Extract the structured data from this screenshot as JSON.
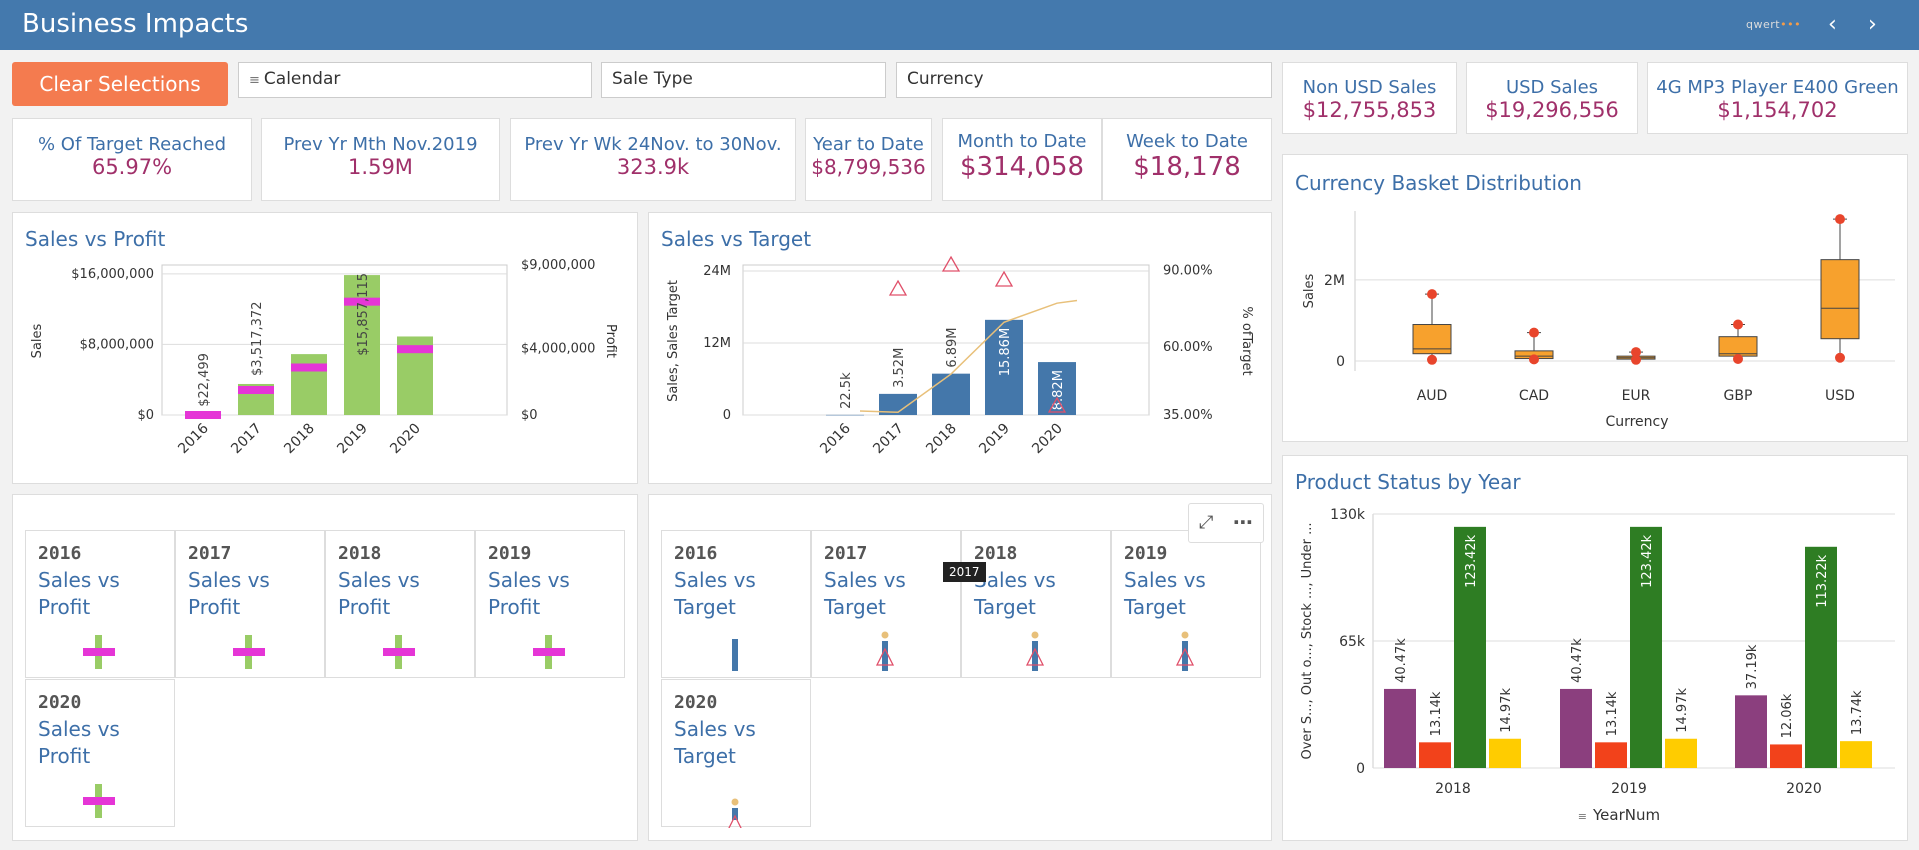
{
  "header": {
    "title": "Business Impacts",
    "logo_text": "qwert",
    "logo_dots": "•••",
    "prev_icon": "chevron-left-icon",
    "next_icon": "chevron-right-icon"
  },
  "toolbar": {
    "clear_label": "Clear Selections",
    "filters": [
      {
        "label": "Calendar",
        "has_icon": true
      },
      {
        "label": "Sale Type",
        "has_icon": false
      },
      {
        "label": "Currency",
        "has_icon": false
      }
    ]
  },
  "top_kpis": [
    {
      "label": "Non USD Sales",
      "value": "$12,755,853"
    },
    {
      "label": "USD Sales",
      "value": "$19,296,556"
    },
    {
      "label": "4G MP3 Player E400 Green",
      "value": "$1,154,702"
    }
  ],
  "kpis": [
    {
      "label": "% Of Target Reached",
      "value": "65.97%"
    },
    {
      "label": "Prev Yr Mth Nov.2019",
      "value": "1.59M"
    },
    {
      "label": "Prev Yr Wk 24Nov. to 30Nov.",
      "value": "323.9k"
    },
    {
      "label": "Year to Date",
      "value": "$8,799,536"
    },
    {
      "label": "Month to Date",
      "value": "$314,058"
    },
    {
      "label": "Week to Date",
      "value": "$18,178"
    }
  ],
  "colors": {
    "green_bar": "#99cc66",
    "magenta": "#e535d6",
    "blue_bar": "#4477aa",
    "orange_box": "#f7a12d",
    "purple": "#8b3f7e",
    "red_orange": "#f2421b",
    "dark_green": "#2e7d23",
    "yellow": "#ffcc00",
    "accent_title": "#3d6fa8",
    "kpi_value": "#a0306a"
  },
  "chart_data": [
    {
      "type": "bar",
      "title": "Sales vs Profit",
      "categories": [
        "2016",
        "2017",
        "2018",
        "2019",
        "2020"
      ],
      "series": [
        {
          "name": "Sales",
          "values": [
            22499,
            3517372,
            6900000,
            15857115,
            8900000
          ],
          "labels": [
            "$22,499",
            "$3,517,372",
            "",
            "$15,857,115",
            ""
          ]
        },
        {
          "name": "Profit",
          "values": [
            0,
            1500000,
            2850000,
            6800000,
            3950000
          ]
        }
      ],
      "ylabel": "Sales",
      "y2label": "Profit",
      "yticks": [
        "$16,000,000",
        "$8,000,000",
        "$0"
      ],
      "y2ticks": [
        "$9,000,000",
        "$4,000,000",
        "$0"
      ],
      "ylim": [
        0,
        17000000
      ],
      "y2lim": [
        0,
        9000000
      ]
    },
    {
      "type": "bar",
      "title": "Sales vs Target",
      "categories": [
        "2016",
        "2017",
        "2018",
        "2019",
        "2020"
      ],
      "series": [
        {
          "name": "Sales",
          "values": [
            22500,
            3520000,
            6890000,
            15860000,
            8820000
          ],
          "labels": [
            "22.5k",
            "3.52M",
            "6.89M",
            "15.86M",
            "8.82M"
          ]
        },
        {
          "name": "Target",
          "values": [
            null,
            21000000,
            25000000,
            22500000,
            1500000
          ]
        },
        {
          "name": "% of Target",
          "values": [
            null,
            36,
            50,
            69,
            76
          ]
        }
      ],
      "ylabel": "Sales, Sales Target",
      "y2label": "% ofTarget",
      "yticks": [
        "24M",
        "12M",
        "0"
      ],
      "y2ticks": [
        "90.00%",
        "60.00%",
        "35.00%"
      ],
      "ylim": [
        0,
        25000000
      ],
      "y2lim": [
        35,
        90
      ]
    },
    {
      "type": "box",
      "title": "Currency Basket Distribution",
      "categories": [
        "AUD",
        "CAD",
        "EUR",
        "GBP",
        "USD"
      ],
      "boxes": [
        {
          "min": 30000,
          "q1": 180000,
          "median": 300000,
          "q3": 900000,
          "max": 1650000
        },
        {
          "min": 40000,
          "q1": 60000,
          "median": 120000,
          "q3": 250000,
          "max": 700000
        },
        {
          "min": 30000,
          "q1": 50000,
          "median": 80000,
          "q3": 120000,
          "max": 220000
        },
        {
          "min": 50000,
          "q1": 120000,
          "median": 180000,
          "q3": 600000,
          "max": 900000
        },
        {
          "min": 80000,
          "q1": 550000,
          "median": 1300000,
          "q3": 2500000,
          "max": 3500000
        }
      ],
      "xlabel": "Currency",
      "ylabel": "Sales",
      "yticks": [
        "2M",
        "0"
      ],
      "ylim": [
        0,
        3700000
      ]
    },
    {
      "type": "bar",
      "title": "Product Status by Year",
      "categories": [
        "2018",
        "2019",
        "2020"
      ],
      "series": [
        {
          "name": "Over Stock",
          "values": [
            40470,
            40470,
            37190
          ],
          "labels": [
            "40.47k",
            "40.47k",
            "37.19k"
          ]
        },
        {
          "name": "Out of Stock",
          "values": [
            13140,
            13140,
            12060
          ],
          "labels": [
            "13.14k",
            "13.14k",
            "12.06k"
          ]
        },
        {
          "name": "Stock",
          "values": [
            123420,
            123420,
            113220
          ],
          "labels": [
            "123.42k",
            "123.42k",
            "113.22k"
          ]
        },
        {
          "name": "Under Stock",
          "values": [
            14970,
            14970,
            13740
          ],
          "labels": [
            "14.97k",
            "14.97k",
            "13.74k"
          ]
        }
      ],
      "xlabel": "YearNum",
      "ylabel": "Over S..., Out o..., Stock ..., Under ...",
      "yticks": [
        "130k",
        "65k",
        "0"
      ],
      "ylim": [
        0,
        130000
      ]
    }
  ],
  "profit_cards": [
    {
      "year": "2016",
      "title": "Sales vs Profit"
    },
    {
      "year": "2017",
      "title": "Sales vs Profit"
    },
    {
      "year": "2018",
      "title": "Sales vs Profit"
    },
    {
      "year": "2019",
      "title": "Sales vs Profit"
    },
    {
      "year": "2020",
      "title": "Sales vs Profit"
    }
  ],
  "target_cards": [
    {
      "year": "2016",
      "title": "Sales vs Target"
    },
    {
      "year": "2017",
      "title": "Sales vs Target"
    },
    {
      "year": "2018",
      "title": "Sales vs Target"
    },
    {
      "year": "2019",
      "title": "Sales vs Target"
    },
    {
      "year": "2020",
      "title": "Sales vs Target"
    }
  ],
  "tooltip": "2017",
  "panel_tools": {
    "expand_icon": "expand-icon",
    "more_icon": "more-icon"
  }
}
